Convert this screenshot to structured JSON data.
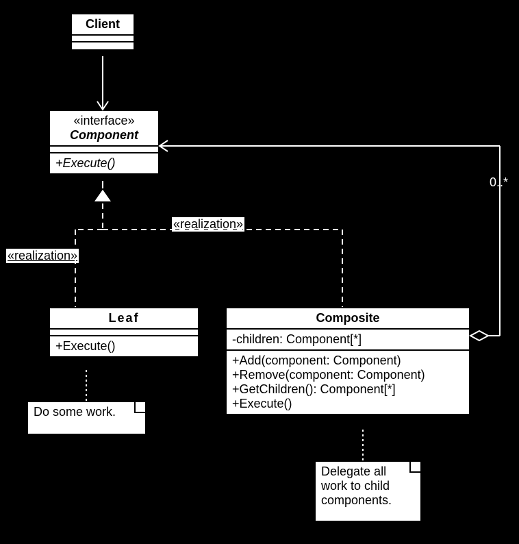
{
  "client": {
    "name": "Client"
  },
  "component": {
    "stereotype": "«interface»",
    "name": "Component",
    "operation": "+Execute()"
  },
  "leaf": {
    "name": "Leaf",
    "operation": "+Execute()"
  },
  "composite": {
    "name": "Composite",
    "attribute": "-children: Component[*]",
    "op1": "+Add(component: Component)",
    "op2": "+Remove(component: Component)",
    "op3": "+GetChildren(): Component[*]",
    "op4": "+Execute()"
  },
  "labels": {
    "realization1": "«realization»",
    "realization2": "«realization»",
    "multiplicity": "0..*"
  },
  "notes": {
    "leaf_note": "Do some work.",
    "composite_note_l1": "Delegate all",
    "composite_note_l2": "work to child",
    "composite_note_l3": "components."
  }
}
